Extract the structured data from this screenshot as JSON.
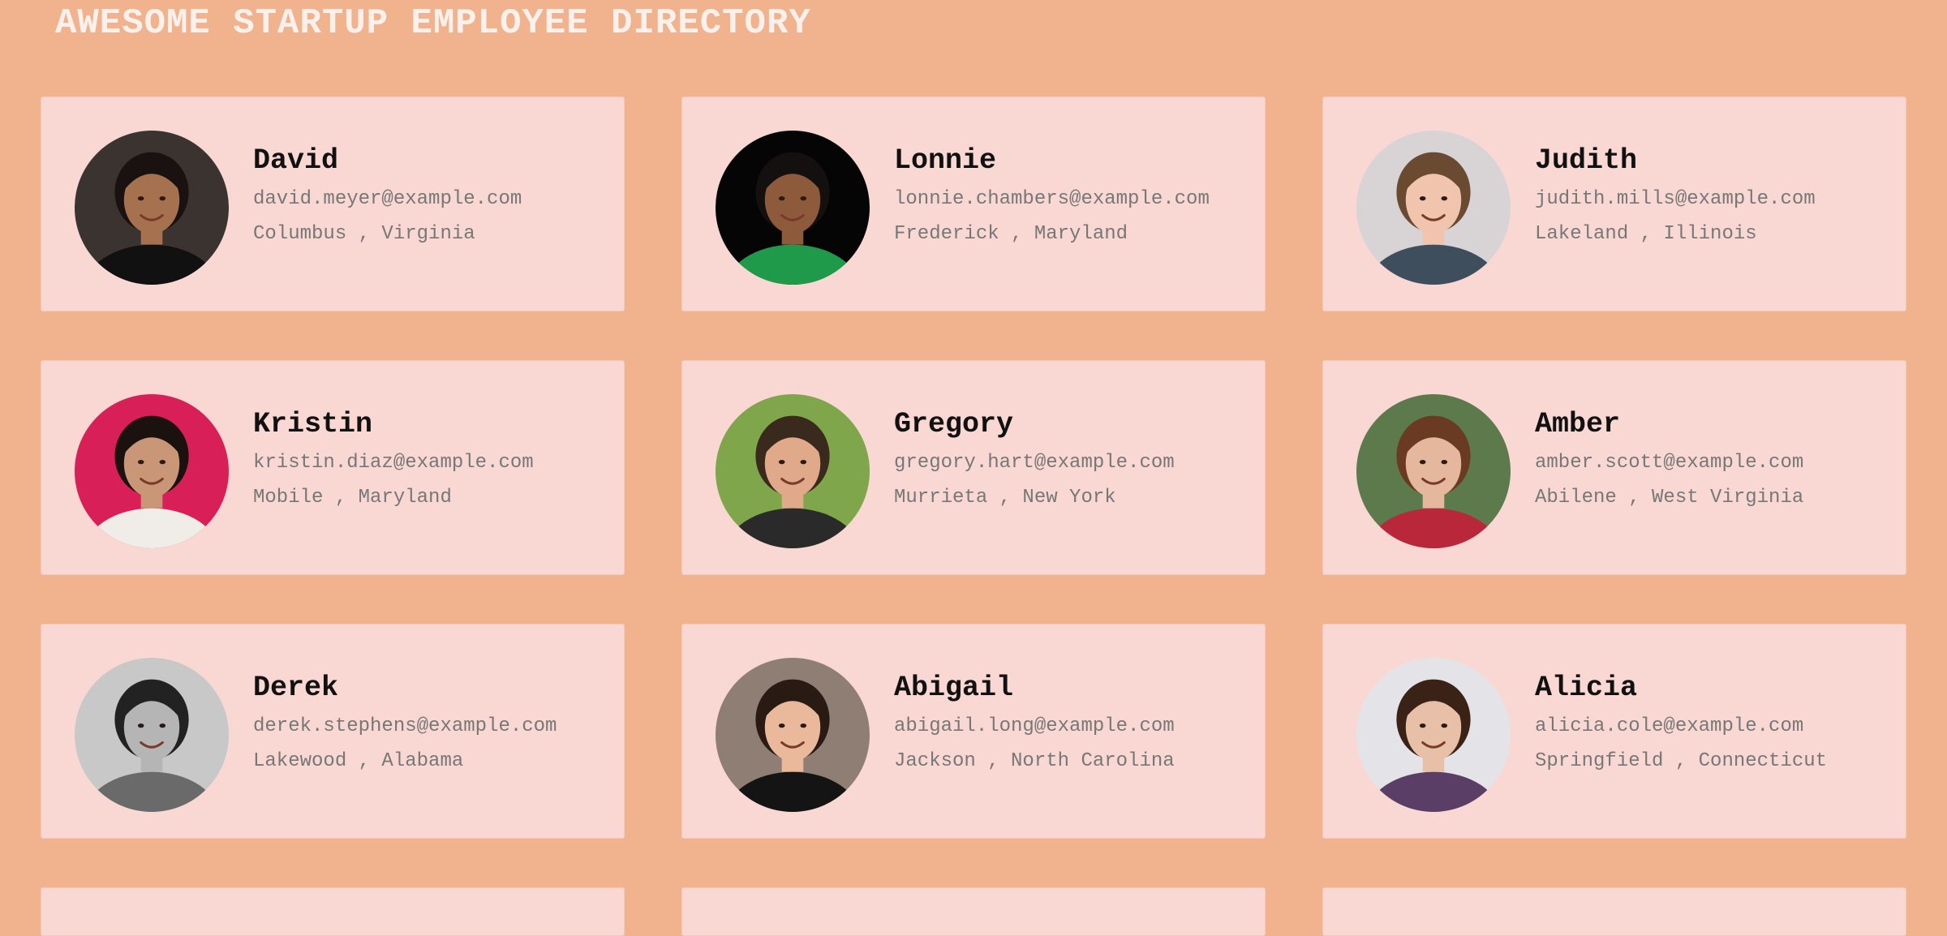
{
  "page": {
    "title": "AWESOME STARTUP EMPLOYEE DIRECTORY",
    "background_color": "#f0b38e",
    "card_color": "#f9d8d3"
  },
  "employees": [
    {
      "name": "David",
      "email": "david.meyer@example.com",
      "location": "Columbus , Virginia",
      "avatar": {
        "bg": "#3a3330",
        "skin": "#a5714f",
        "hair": "#1a1210",
        "shirt": "#111111"
      }
    },
    {
      "name": "Lonnie",
      "email": "lonnie.chambers@example.com",
      "location": "Frederick , Maryland",
      "avatar": {
        "bg": "#050505",
        "skin": "#8d5a3b",
        "hair": "#141010",
        "shirt": "#1f9a4a"
      }
    },
    {
      "name": "Judith",
      "email": "judith.mills@example.com",
      "location": "Lakeland , Illinois",
      "avatar": {
        "bg": "#d8d3d5",
        "skin": "#f0c4ad",
        "hair": "#6b4a32",
        "shirt": "#3e4e5c"
      }
    },
    {
      "name": "Kristin",
      "email": "kristin.diaz@example.com",
      "location": "Mobile , Maryland",
      "avatar": {
        "bg": "#d81f58",
        "skin": "#c99778",
        "hair": "#1b1210",
        "shirt": "#f0ede8"
      }
    },
    {
      "name": "Gregory",
      "email": "gregory.hart@example.com",
      "location": "Murrieta , New York",
      "avatar": {
        "bg": "#7fa64a",
        "skin": "#e0a98a",
        "hair": "#3a2a1e",
        "shirt": "#2a2a2a"
      }
    },
    {
      "name": "Amber",
      "email": "amber.scott@example.com",
      "location": "Abilene , West Virginia",
      "avatar": {
        "bg": "#5d7a4d",
        "skin": "#e5b79d",
        "hair": "#6a3a22",
        "shirt": "#b8283a"
      }
    },
    {
      "name": "Derek",
      "email": "derek.stephens@example.com",
      "location": "Lakewood , Alabama",
      "avatar": {
        "bg": "#c8c8c8",
        "skin": "#b5b5b5",
        "hair": "#222222",
        "shirt": "#6a6a6a"
      }
    },
    {
      "name": "Abigail",
      "email": "abigail.long@example.com",
      "location": "Jackson , North Carolina",
      "avatar": {
        "bg": "#8e7e74",
        "skin": "#eab99c",
        "hair": "#2a1a14",
        "shirt": "#141414"
      }
    },
    {
      "name": "Alicia",
      "email": "alicia.cole@example.com",
      "location": "Springfield , Connecticut",
      "avatar": {
        "bg": "#e4e4e8",
        "skin": "#e8c0a8",
        "hair": "#3a2216",
        "shirt": "#5a3e66"
      }
    },
    {
      "name": "",
      "email": "",
      "location": "",
      "avatar": null
    },
    {
      "name": "",
      "email": "",
      "location": "",
      "avatar": null
    },
    {
      "name": "",
      "email": "",
      "location": "",
      "avatar": null
    }
  ]
}
